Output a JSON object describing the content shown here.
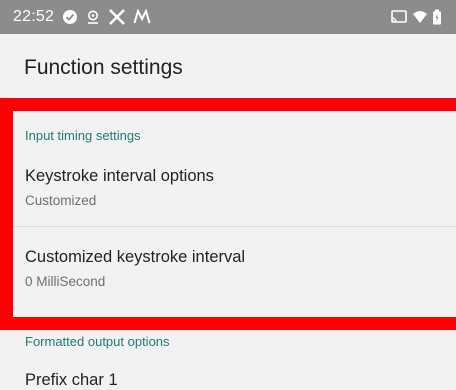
{
  "status_bar": {
    "time": "22:52",
    "left_icons": [
      "check-circle-icon",
      "location-icon",
      "x-logo-icon",
      "m-logo-icon"
    ],
    "right_icons": [
      "cast-icon",
      "wifi-icon",
      "battery-icon"
    ]
  },
  "app_bar": {
    "title": "Function settings"
  },
  "sections": [
    {
      "header": "Input timing settings",
      "items": [
        {
          "title": "Keystroke interval options",
          "summary": "Customized"
        },
        {
          "title": "Customized keystroke interval",
          "summary": "0 MilliSecond"
        }
      ]
    },
    {
      "header": "Formatted output options",
      "items": [
        {
          "title": "Prefix char 1"
        }
      ]
    }
  ],
  "colors": {
    "status_bar": "#8c8c8c",
    "background": "#f2f2f2",
    "section_header": "#1f7a73",
    "highlight": "#ff0000"
  }
}
